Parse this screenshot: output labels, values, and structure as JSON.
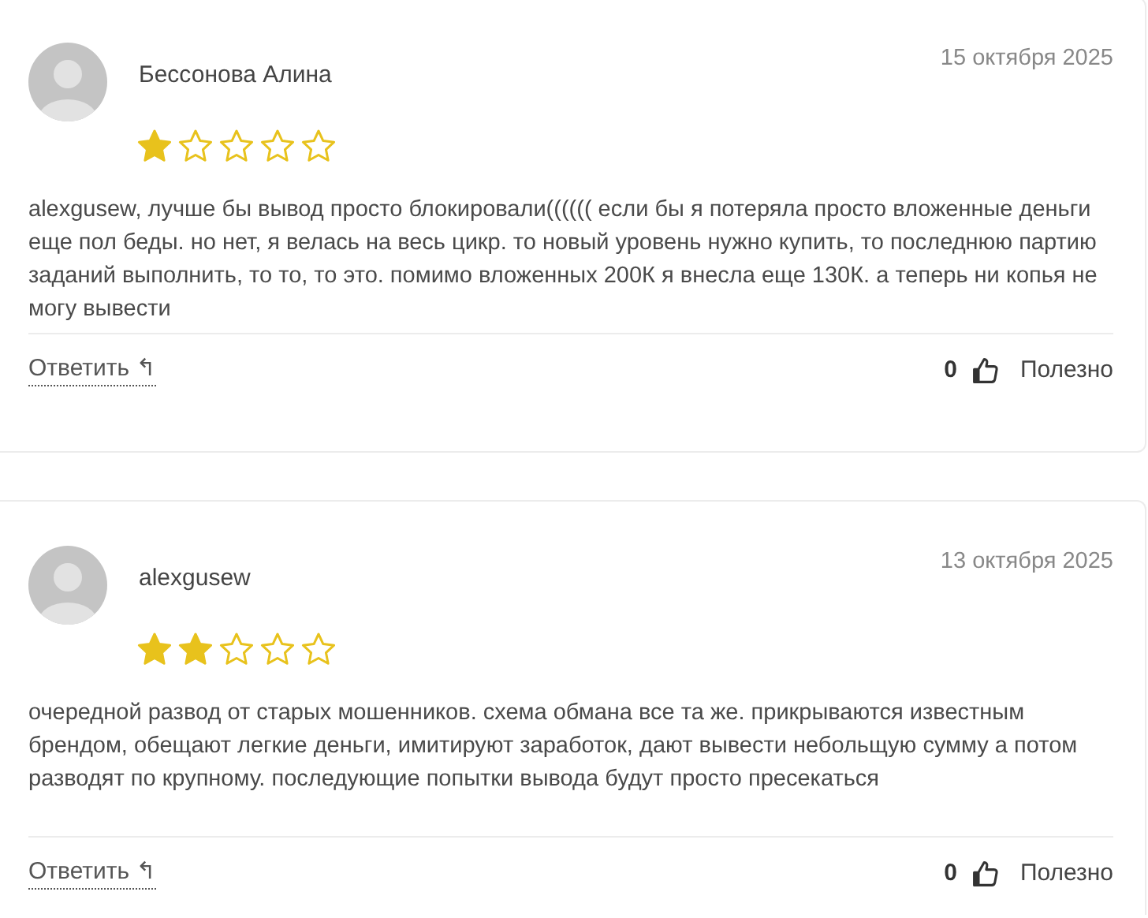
{
  "reviews": [
    {
      "author": "Бессонова Алина",
      "date": "15 октября 2025",
      "stars": 1,
      "text": "alexgusew, лучше бы вывод просто блокировали(((((( если бы я потеряла просто вложенные деньги еще пол беды. но нет, я велась на весь цикр. то новый уровень нужно купить, то последнюю партию заданий выполнить, то то, то это. помимо вложенных 200К я внесла еще 130К. а теперь ни копья не могу вывести",
      "reply": "Ответить",
      "reply_icon": "↰",
      "likes": "0",
      "helpful": "Полезно"
    },
    {
      "author": "alexgusew",
      "date": "13 октября 2025",
      "stars": 2,
      "text": "очередной развод от старых мошенников. схема обмана все та же. прикрываются известным брендом, обещают легкие деньги, имитируют заработок, дают вывести небольщую сумму а потом разводят по крупному. последующие попытки вывода будут просто пресекаться",
      "reply": "Ответить",
      "reply_icon": "↰",
      "likes": "0",
      "helpful": "Полезно"
    }
  ]
}
